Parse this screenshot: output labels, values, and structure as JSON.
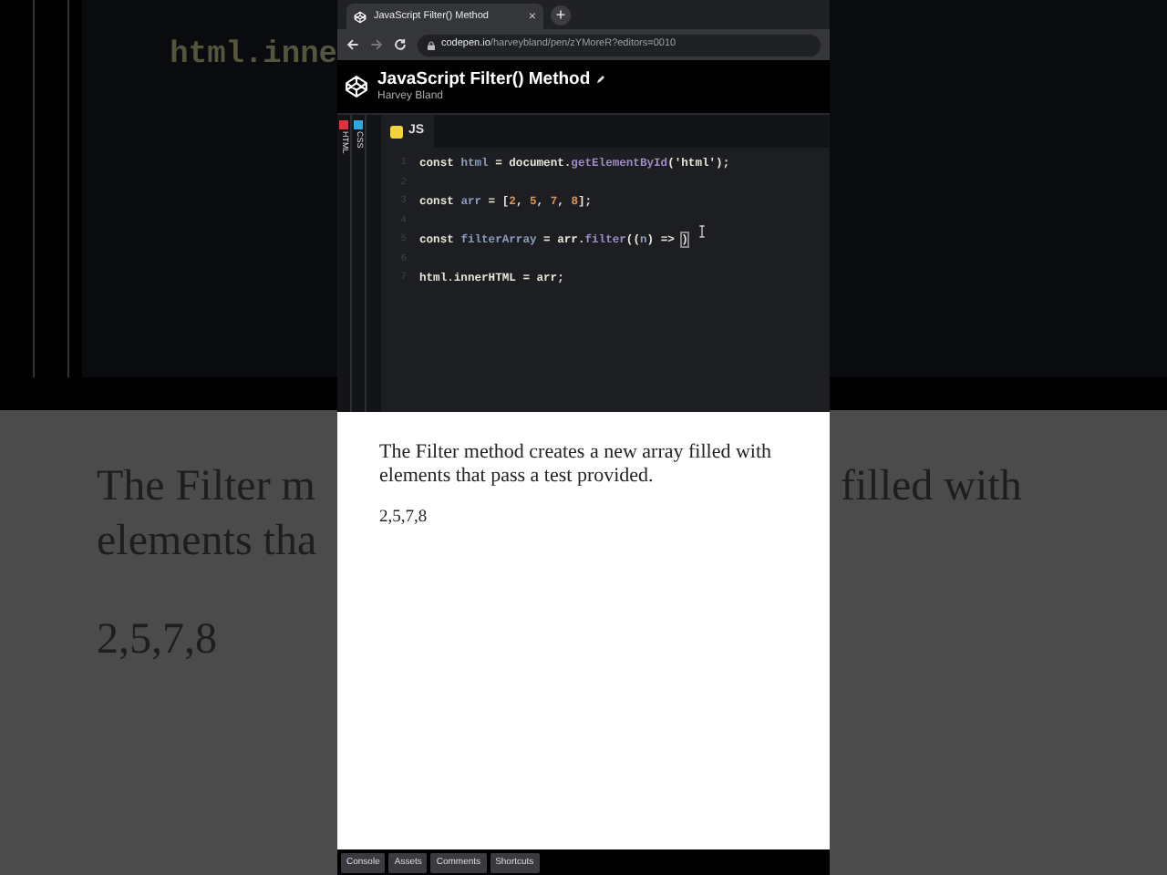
{
  "backdrop": {
    "code_fragment": "html.inne",
    "left_lines": [
      "The Filter m",
      "elements tha"
    ],
    "left_output": "2,5,7,8",
    "right_lines": [
      "filled with"
    ]
  },
  "browser": {
    "tab_title": "JavaScript Filter() Method",
    "close": "×",
    "new_tab": "+",
    "url_host": "codepen.io",
    "url_path": "/harveybland/pen/zYMoreR?editors=0010"
  },
  "pen": {
    "title": "JavaScript Filter() Method",
    "author": "Harvey Bland"
  },
  "panes": [
    {
      "label": "HTML",
      "color": "#e0323c"
    },
    {
      "label": "CSS",
      "color": "#2fa8e0"
    }
  ],
  "editor": {
    "tab": "JS",
    "lines": [
      {
        "number": "1",
        "tokens": [
          {
            "text": "const ",
            "kind": "keyword"
          },
          {
            "text": "html",
            "kind": "variable"
          },
          {
            "text": " = ",
            "kind": "punct"
          },
          {
            "text": "document",
            "kind": "keyword"
          },
          {
            "text": ".",
            "kind": "punct"
          },
          {
            "text": "getElementById",
            "kind": "function"
          },
          {
            "text": "(",
            "kind": "punct"
          },
          {
            "text": "'html'",
            "kind": "string"
          },
          {
            "text": ");",
            "kind": "punct"
          }
        ]
      },
      {
        "number": "2"
      },
      {
        "number": "3",
        "tokens": [
          {
            "text": "const ",
            "kind": "keyword"
          },
          {
            "text": "arr",
            "kind": "variable"
          },
          {
            "text": " = [",
            "kind": "punct"
          },
          {
            "text": "2",
            "kind": "number"
          },
          {
            "text": ", ",
            "kind": "punct"
          },
          {
            "text": "5",
            "kind": "number"
          },
          {
            "text": ", ",
            "kind": "punct"
          },
          {
            "text": "7",
            "kind": "number"
          },
          {
            "text": ", ",
            "kind": "punct"
          },
          {
            "text": "8",
            "kind": "number"
          },
          {
            "text": "];",
            "kind": "punct"
          }
        ]
      },
      {
        "number": "4"
      },
      {
        "number": "5",
        "tokens": [
          {
            "text": "const ",
            "kind": "keyword"
          },
          {
            "text": "filterArray",
            "kind": "variable"
          },
          {
            "text": " = ",
            "kind": "punct"
          },
          {
            "text": "arr",
            "kind": "keyword"
          },
          {
            "text": ".",
            "kind": "punct"
          },
          {
            "text": "filter",
            "kind": "function"
          },
          {
            "text": "((",
            "kind": "punct"
          },
          {
            "text": "n",
            "kind": "variable"
          },
          {
            "text": ") => ",
            "kind": "punct"
          },
          {
            "text": ")",
            "kind": "bracket"
          }
        ]
      },
      {
        "number": "6"
      },
      {
        "number": "7",
        "tokens": [
          {
            "text": "html",
            "kind": "keyword"
          },
          {
            "text": ".innerHTML = ",
            "kind": "keyword"
          },
          {
            "text": "arr",
            "kind": "keyword"
          },
          {
            "text": ";",
            "kind": "punct"
          }
        ]
      }
    ]
  },
  "preview": {
    "paragraph": "The Filter method creates a new array filled with elements that pass a test provided.",
    "output": "2,5,7,8"
  },
  "footer_buttons": [
    "Console",
    "Assets",
    "Comments",
    "Shortcuts"
  ]
}
